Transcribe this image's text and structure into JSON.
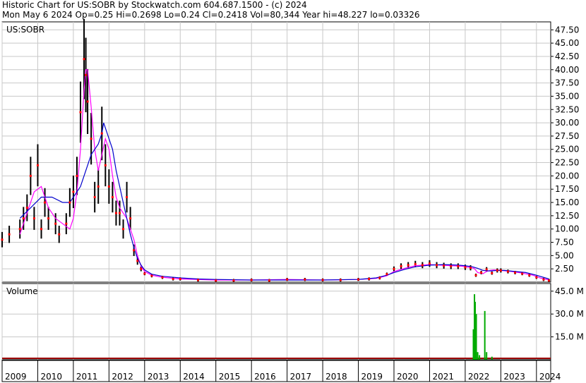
{
  "header": {
    "line1": "Historic Chart for US:SOBR by Stockwatch.com 604.687.1500 - (c) 2024",
    "line2": "Mon May  6 2024   Op=0.25  Hi=0.2698   Lo=0.24   Cl=0.2418   Vol=80,344   Year hi=48.227   lo=0.03326"
  },
  "colors": {
    "candle": "#000000",
    "close_dot": "#ff0000",
    "ma_short": "#ff00ff",
    "ma_long": "#0000cc",
    "volume": "#00aa00",
    "grid": "#c8c8c8"
  },
  "chart_data": [
    {
      "type": "line",
      "label": "US:SOBR",
      "y_ticks": [
        "2.50",
        "5.00",
        "7.50",
        "10.00",
        "12.50",
        "15.00",
        "17.50",
        "20.00",
        "22.50",
        "25.00",
        "27.50",
        "30.00",
        "32.50",
        "35.00",
        "37.50",
        "40.00",
        "42.50",
        "45.00",
        "47.50"
      ],
      "x_ticks": [
        "2009",
        "2010",
        "2011",
        "2012",
        "2013",
        "2014",
        "2015",
        "2016",
        "2017",
        "2018",
        "2019",
        "2020",
        "2021",
        "2022",
        "2023",
        "2024"
      ],
      "ylim": [
        0,
        49
      ],
      "xlim": [
        2009.0,
        2024.4
      ],
      "grid": true,
      "series": [
        {
          "name": "",
          "style": "close",
          "x": [
            2009.0,
            2009.2,
            2009.5,
            2009.6,
            2009.7,
            2009.8,
            2009.9,
            2010.0,
            2010.1,
            2010.2,
            2010.3,
            2010.5,
            2010.6,
            2010.8,
            2010.9,
            2011.0,
            2011.1,
            2011.2,
            2011.3,
            2011.35,
            2011.4,
            2011.5,
            2011.6,
            2011.7,
            2011.8,
            2011.9,
            2012.0,
            2012.1,
            2012.2,
            2012.3,
            2012.4,
            2012.5,
            2012.6,
            2012.7,
            2012.8,
            2012.9,
            2013.0,
            2013.2,
            2013.5,
            2013.8,
            2014.0,
            2014.5,
            2015.0,
            2015.5,
            2016.0,
            2016.5,
            2017.0,
            2017.5,
            2018.0,
            2018.5,
            2019.0,
            2019.3,
            2019.6,
            2019.8,
            2020.0,
            2020.2,
            2020.4,
            2020.6,
            2020.8,
            2021.0,
            2021.2,
            2021.4,
            2021.6,
            2021.8,
            2022.0,
            2022.15,
            2022.3,
            2022.45,
            2022.6,
            2022.75,
            2022.9,
            2023.0,
            2023.2,
            2023.4,
            2023.6,
            2023.8,
            2024.0,
            2024.2,
            2024.35
          ],
          "y": [
            8,
            9,
            10,
            12,
            14,
            20,
            12,
            22,
            10,
            15,
            12,
            11,
            9,
            11,
            15,
            17,
            20,
            32,
            42,
            39,
            34,
            27,
            16,
            18,
            28,
            22,
            18,
            16,
            13,
            13,
            10,
            16,
            12,
            6,
            4,
            2.5,
            1.6,
            1.2,
            0.9,
            0.6,
            0.6,
            0.4,
            0.3,
            0.3,
            0.4,
            0.3,
            0.5,
            0.5,
            0.4,
            0.4,
            0.5,
            0.6,
            0.8,
            1.5,
            2.5,
            3,
            3.2,
            3.4,
            3.2,
            3.5,
            3.2,
            3.1,
            3,
            3,
            2.8,
            2.7,
            1.3,
            1.8,
            2.4,
            1.7,
            2.2,
            2.2,
            2,
            1.8,
            1.6,
            1.3,
            0.9,
            0.5,
            0.3
          ]
        },
        {
          "name": "",
          "style": "ma_short",
          "x": [
            2009.5,
            2009.7,
            2009.9,
            2010.1,
            2010.3,
            2010.5,
            2010.7,
            2010.9,
            2011.0,
            2011.1,
            2011.2,
            2011.3,
            2011.35,
            2011.4,
            2011.5,
            2011.6,
            2011.7,
            2011.8,
            2011.9,
            2012.0,
            2012.1,
            2012.2,
            2012.3,
            2012.4,
            2012.5,
            2012.6,
            2012.7,
            2012.8,
            2012.9,
            2013.0,
            2013.2,
            2013.5,
            2014.0,
            2015.0,
            2016.0,
            2017.0,
            2018.0,
            2019.0,
            2019.5,
            2019.8,
            2020.0,
            2020.3,
            2020.6,
            2021.0,
            2021.3,
            2021.6,
            2021.9,
            2022.1,
            2022.25,
            2022.35,
            2022.5,
            2022.6,
            2022.7,
            2022.8,
            2023.0,
            2023.3,
            2023.6,
            2023.9,
            2024.1,
            2024.35
          ],
          "y": [
            9,
            13,
            17,
            18,
            14,
            12,
            11,
            10,
            12,
            17,
            25,
            36,
            40,
            40,
            33,
            25,
            21,
            24,
            27,
            25,
            20,
            16,
            14,
            13,
            12,
            10,
            8,
            5,
            3,
            2,
            1.3,
            0.9,
            0.6,
            0.4,
            0.4,
            0.5,
            0.4,
            0.5,
            0.7,
            1.2,
            2,
            2.6,
            3.1,
            3.3,
            3.2,
            3.1,
            3,
            2.8,
            2.6,
            1.8,
            1.6,
            2,
            2.2,
            2.3,
            2.2,
            2,
            1.7,
            1.3,
            0.8,
            0.4
          ]
        },
        {
          "name": "",
          "style": "ma_long",
          "x": [
            2009.5,
            2009.8,
            2010.1,
            2010.4,
            2010.7,
            2010.9,
            2011.0,
            2011.2,
            2011.4,
            2011.5,
            2011.6,
            2011.7,
            2011.8,
            2011.85,
            2011.9,
            2012.0,
            2012.1,
            2012.2,
            2012.3,
            2012.4,
            2012.5,
            2012.6,
            2012.7,
            2012.8,
            2012.9,
            2013.0,
            2013.2,
            2013.5,
            2014.0,
            2014.5,
            2015.0,
            2016.0,
            2017.0,
            2018.0,
            2019.0,
            2019.5,
            2019.8,
            2020.0,
            2020.3,
            2020.6,
            2021.0,
            2021.4,
            2021.8,
            2022.0,
            2022.2,
            2022.35,
            2022.5,
            2022.7,
            2022.9,
            2023.1,
            2023.4,
            2023.7,
            2024.0,
            2024.35
          ],
          "y": [
            12,
            14,
            16,
            16,
            15,
            15,
            16,
            18,
            22,
            24,
            25,
            26,
            28,
            30,
            29,
            27,
            25,
            21,
            18,
            15,
            12,
            9,
            6.5,
            4.5,
            3.2,
            2.3,
            1.5,
            1.1,
            0.8,
            0.6,
            0.5,
            0.4,
            0.4,
            0.4,
            0.5,
            0.8,
            1.3,
            1.8,
            2.4,
            2.9,
            3.2,
            3.3,
            3.2,
            3.1,
            2.9,
            2.6,
            2.2,
            2.1,
            2.2,
            2.2,
            2,
            1.8,
            1.3,
            0.6
          ]
        }
      ]
    },
    {
      "type": "bar",
      "label": "Volume",
      "y_ticks": [
        "15.0 M",
        "30.0 M",
        "45.0 M"
      ],
      "ylim": [
        0,
        50
      ],
      "grid": true,
      "x": [
        2022.23,
        2022.26,
        2022.28,
        2022.31,
        2022.35,
        2022.4,
        2022.55,
        2022.6,
        2022.75
      ],
      "values": [
        20,
        43,
        38,
        30,
        5,
        3,
        32,
        5,
        2
      ]
    }
  ]
}
